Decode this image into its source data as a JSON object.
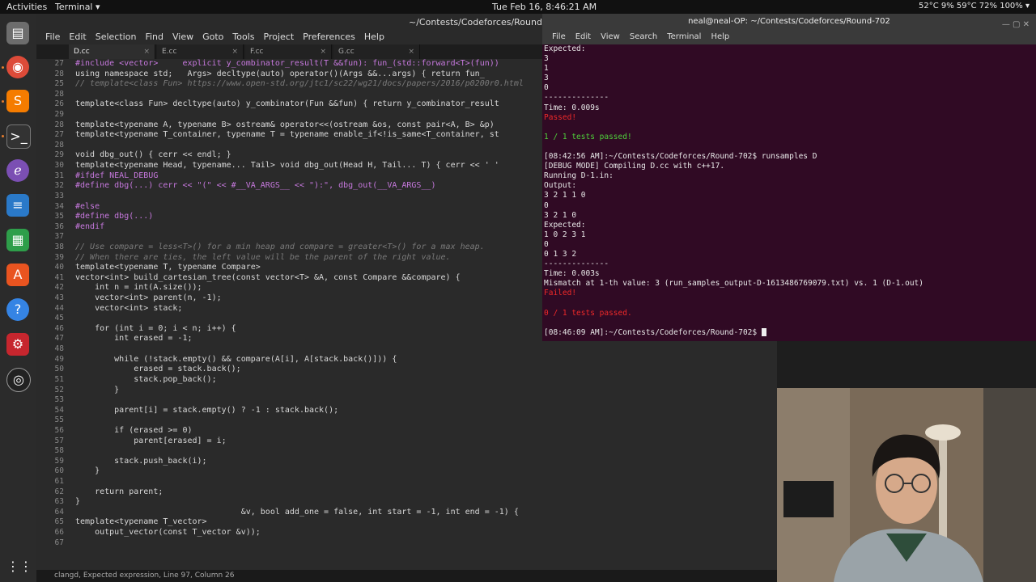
{
  "topbar": {
    "activities": "Activities",
    "app": "Terminal ▾",
    "clock": "Tue Feb 16, 8:46:21 AM",
    "status": "52°C 9% 59°C 72%   100% ▾"
  },
  "editor": {
    "title": "~/Contests/Codeforces/Round-702",
    "menu": [
      "File",
      "Edit",
      "Selection",
      "Find",
      "View",
      "Goto",
      "Tools",
      "Project",
      "Preferences",
      "Help"
    ],
    "tabs": [
      "D.cc",
      "E.cc",
      "F.cc",
      "G.cc"
    ],
    "line_numbers": [
      "27",
      "28",
      "25",
      "28",
      "26",
      "29",
      "28",
      "27",
      "28",
      "29",
      "30",
      "31",
      "32",
      "33",
      "34",
      "35",
      "36",
      "37",
      "38",
      "39",
      "40",
      "41",
      "42",
      "43",
      "44",
      "45",
      "46",
      "47",
      "48",
      "49",
      "50",
      "51",
      "52",
      "53",
      "54",
      "55",
      "56",
      "57",
      "58",
      "59",
      "60",
      "61",
      "62",
      "63",
      "64",
      "65",
      "66",
      "67"
    ],
    "lines": [
      "#include <vector>     explicit y_combinator_result(T &&fun): fun_(std::forward<T>(fun))",
      "using namespace std;   Args> decltype(auto) operator()(Args &&...args) { return fun_",
      "// template<class Fun> https://www.open-std.org/jtc1/sc22/wg21/docs/papers/2016/p0200r0.html",
      "",
      "template<class Fun> decltype(auto) y_combinator(Fun &&fun) { return y_combinator_result",
      "",
      "template<typename A, typename B> ostream& operator<<(ostream &os, const pair<A, B> &p)",
      "template<typename T_container, typename T = typename enable_if<!is_same<T_container, st",
      "",
      "void dbg_out() { cerr << endl; }",
      "template<typename Head, typename... Tail> void dbg_out(Head H, Tail... T) { cerr << ' '",
      "#ifdef NEAL_DEBUG",
      "#define dbg(...) cerr << \"(\" << #__VA_ARGS__ << \"):\", dbg_out(__VA_ARGS__)",
      "",
      "#else",
      "#define dbg(...)",
      "#endif",
      "",
      "// Use compare = less<T>() for a min heap and compare = greater<T>() for a max heap.",
      "// When there are ties, the left value will be the parent of the right value.",
      "template<typename T, typename Compare>",
      "vector<int> build_cartesian_tree(const vector<T> &A, const Compare &&compare) {",
      "    int n = int(A.size());",
      "    vector<int> parent(n, -1);",
      "    vector<int> stack;",
      "",
      "    for (int i = 0; i < n; i++) {",
      "        int erased = -1;",
      "",
      "        while (!stack.empty() && compare(A[i], A[stack.back()])) {",
      "            erased = stack.back();",
      "            stack.pop_back();",
      "        }",
      "",
      "        parent[i] = stack.empty() ? -1 : stack.back();",
      "",
      "        if (erased >= 0)",
      "            parent[erased] = i;",
      "",
      "        stack.push_back(i);",
      "    }",
      "",
      "    return parent;",
      "}",
      "                                  &v, bool add_one = false, int start = -1, int end = -1) {",
      "template<typename T_vector>",
      "    output_vector(const T_vector &v));",
      ""
    ],
    "status": "clangd, Expected expression, Line 97, Column 26"
  },
  "terminal": {
    "title": "neal@neal-OP: ~/Contests/Codeforces/Round-702",
    "menu": [
      "File",
      "Edit",
      "View",
      "Search",
      "Terminal",
      "Help"
    ],
    "lines": [
      {
        "text": "Expected:",
        "c": ""
      },
      {
        "text": "3",
        "c": ""
      },
      {
        "text": "1",
        "c": ""
      },
      {
        "text": "3",
        "c": ""
      },
      {
        "text": "0",
        "c": ""
      },
      {
        "text": "--------------",
        "c": ""
      },
      {
        "text": "Time: 0.009s",
        "c": ""
      },
      {
        "text": "Passed!",
        "c": "red"
      },
      {
        "text": "",
        "c": ""
      },
      {
        "text": "1 / 1 tests passed!",
        "c": "green"
      },
      {
        "text": "",
        "c": ""
      },
      {
        "text": "[08:42:56 AM]:~/Contests/Codeforces/Round-702$ runsamples D",
        "c": ""
      },
      {
        "text": "[DEBUG MODE] Compiling D.cc with c++17.",
        "c": ""
      },
      {
        "text": "Running D-1.in:",
        "c": ""
      },
      {
        "text": "Output:",
        "c": ""
      },
      {
        "text": "3 2 1 1 0",
        "c": ""
      },
      {
        "text": "0",
        "c": ""
      },
      {
        "text": "3 2 1 0",
        "c": ""
      },
      {
        "text": "Expected:",
        "c": ""
      },
      {
        "text": "1 0 2 3 1",
        "c": ""
      },
      {
        "text": "0",
        "c": ""
      },
      {
        "text": "0 1 3 2",
        "c": ""
      },
      {
        "text": "--------------",
        "c": ""
      },
      {
        "text": "Time: 0.003s",
        "c": ""
      },
      {
        "text": "Mismatch at 1-th value: 3 (run_samples_output-D-1613486769079.txt) vs. 1 (D-1.out)",
        "c": ""
      },
      {
        "text": "Failed!",
        "c": "red"
      },
      {
        "text": "",
        "c": ""
      },
      {
        "text": "0 / 1 tests passed.",
        "c": "red"
      },
      {
        "text": "",
        "c": ""
      },
      {
        "text": "[08:46:09 AM]:~/Contests/Codeforces/Round-702$ ",
        "c": "prompt"
      }
    ]
  },
  "dock": {
    "icons": [
      "files-icon",
      "chrome-icon",
      "sublime-icon",
      "terminal-icon",
      "emacs-icon",
      "writer-icon",
      "calc-icon",
      "software-icon",
      "help-icon",
      "settings-icon",
      "obs-icon",
      "apps-grid-icon"
    ]
  }
}
